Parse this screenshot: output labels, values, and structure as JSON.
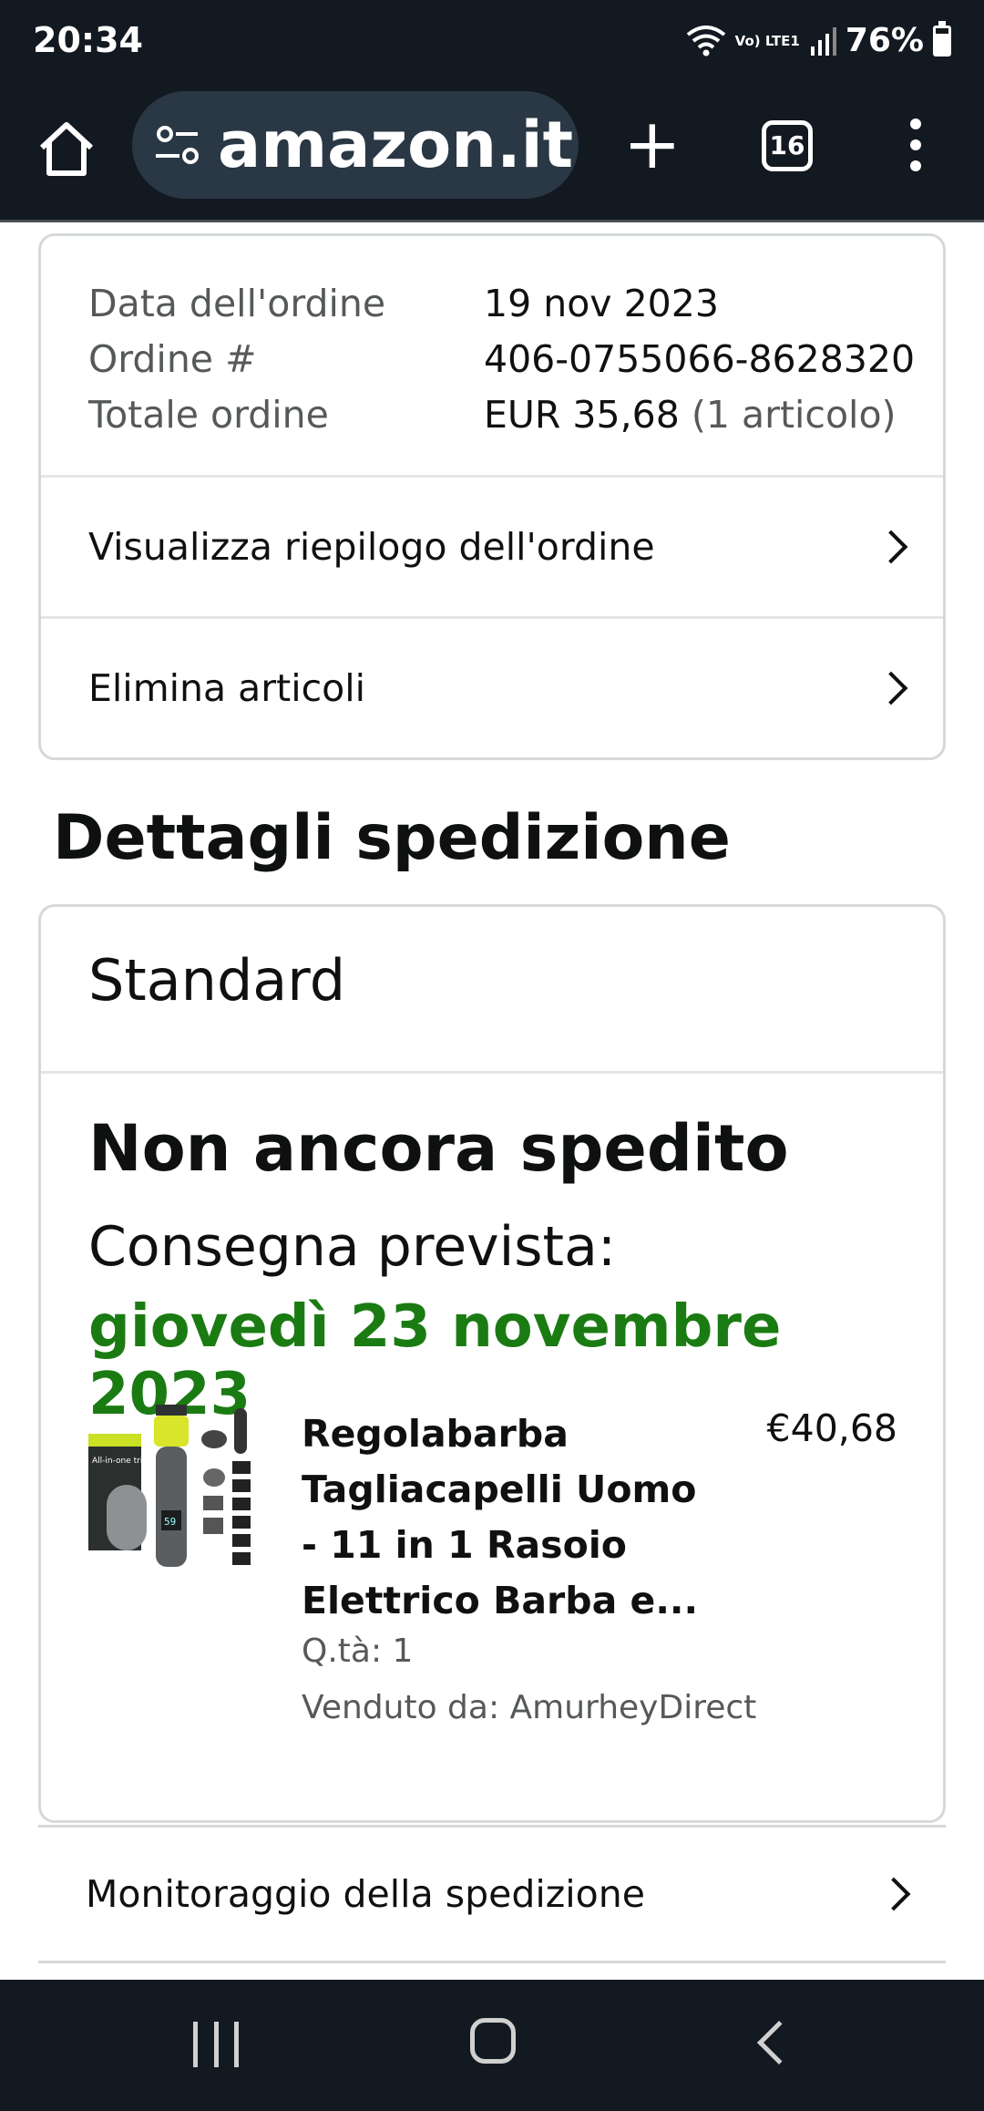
{
  "status_bar": {
    "time": "20:34",
    "network": "Vo) LTE1",
    "battery": "76%",
    "battery_level": 0.76
  },
  "browser": {
    "url": "amazon.it/g",
    "tab_count": "16"
  },
  "order": {
    "date_label": "Data dell'ordine",
    "date_value": "19 nov 2023",
    "number_label": "Ordine #",
    "number_value": "406-0755066-8628320",
    "total_label": "Totale ordine",
    "total_value": "EUR 35,68",
    "total_items": "(1 articolo)",
    "summary_link": "Visualizza riepilogo dell'ordine",
    "delete_link": "Elimina articoli"
  },
  "shipment": {
    "section_title": "Dettagli spedizione",
    "method": "Standard",
    "status": "Non ancora spedito",
    "delivery_label": "Consegna prevista:",
    "delivery_date": "giovedì 23 novembre 2023",
    "product": {
      "title": "Regolabarba Tagliacapelli Uomo - 11 in 1 Rasoio Elettrico Barba e...",
      "price": "€40,68",
      "quantity": "Q.tà: 1",
      "seller": "Venduto da: AmurheyDirect",
      "box_text": "All-in-one trimmer",
      "display_text": "59"
    },
    "tracking_link": "Monitoraggio della spedizione"
  },
  "colors": {
    "header_bg": "#131921",
    "delivery_green": "#1b7b13",
    "border": "#d5d9d9"
  }
}
